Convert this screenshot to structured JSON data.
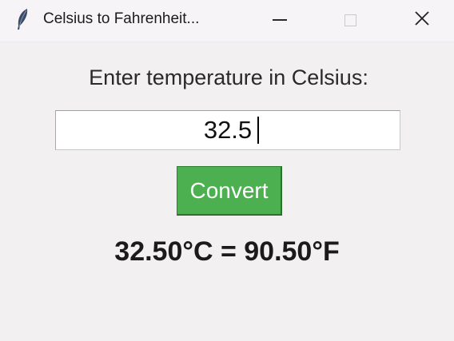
{
  "window": {
    "title": "Celsius to Fahrenheit...",
    "app_icon": "feather-icon",
    "controls": {
      "minimize_icon": "minimize-icon",
      "maximize_icon": "maximize-icon",
      "close_icon": "close-icon"
    }
  },
  "form": {
    "prompt_label": "Enter temperature in Celsius:",
    "celsius_value": "32.5",
    "convert_label": "Convert",
    "convert_color": "#4caf50"
  },
  "result": {
    "text": "32.50°C = 90.50°F"
  }
}
